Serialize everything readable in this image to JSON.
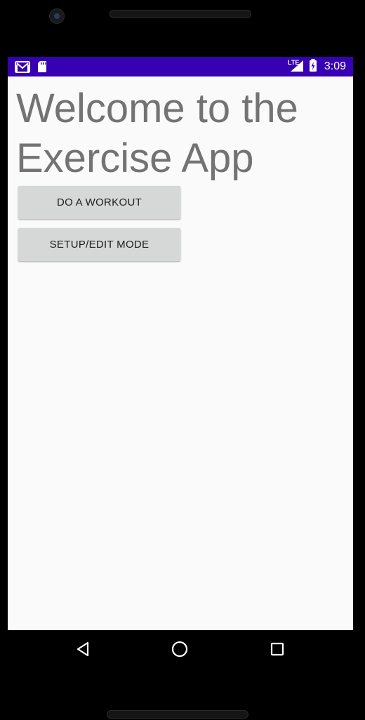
{
  "status_bar": {
    "time": "3:09",
    "network_label": "LTE",
    "icons": [
      "gmail-notification-icon",
      "sd-card-icon",
      "lte-signal-icon",
      "battery-charging-icon"
    ],
    "color": "#3700b3"
  },
  "main": {
    "title": "Welcome to the Exercise App",
    "buttons": {
      "workout": "DO A WORKOUT",
      "setup": "SETUP/EDIT MODE"
    }
  },
  "nav_bar": {
    "icons": [
      "back-icon",
      "home-icon",
      "recents-icon"
    ]
  },
  "colors": {
    "background": "#fafafa",
    "title_text": "#737373",
    "button_bg": "#d6d7d7"
  }
}
